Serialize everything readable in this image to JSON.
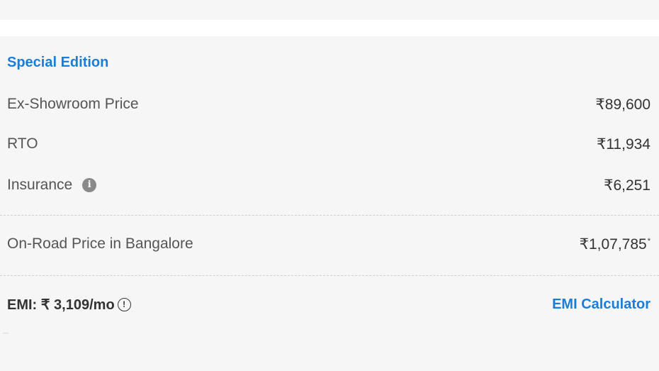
{
  "variant": {
    "title": "Special Edition"
  },
  "price_rows": [
    {
      "label": "Ex-Showroom Price",
      "value": "₹89,600"
    },
    {
      "label": "RTO",
      "value": "₹11,934"
    },
    {
      "label": "Insurance",
      "value": "₹6,251",
      "info_icon": "i"
    }
  ],
  "on_road": {
    "label": "On-Road Price in Bangalore",
    "value": "₹1,07,785",
    "footnote_mark": "*"
  },
  "emi": {
    "text": "EMI: ₹ 3,109/mo",
    "info_icon": "!",
    "calculator_link": "EMI Calculator"
  },
  "colors": {
    "accent": "#1a7dd7",
    "background": "#f6f6f6"
  },
  "icons": {
    "insurance_info": "info-icon",
    "emi_info": "alert-circle-icon"
  }
}
